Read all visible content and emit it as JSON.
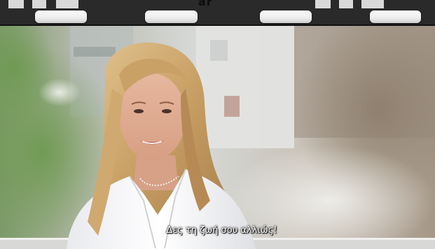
{
  "header": {
    "partial_text": "ar",
    "buttons": [
      {
        "name": "top-button-1"
      },
      {
        "name": "top-button-2"
      },
      {
        "name": "top-button-3"
      },
      {
        "name": "top-button-4"
      }
    ]
  },
  "video": {
    "subtitle": "Δες τη ζωή σου αλλιώς!"
  }
}
